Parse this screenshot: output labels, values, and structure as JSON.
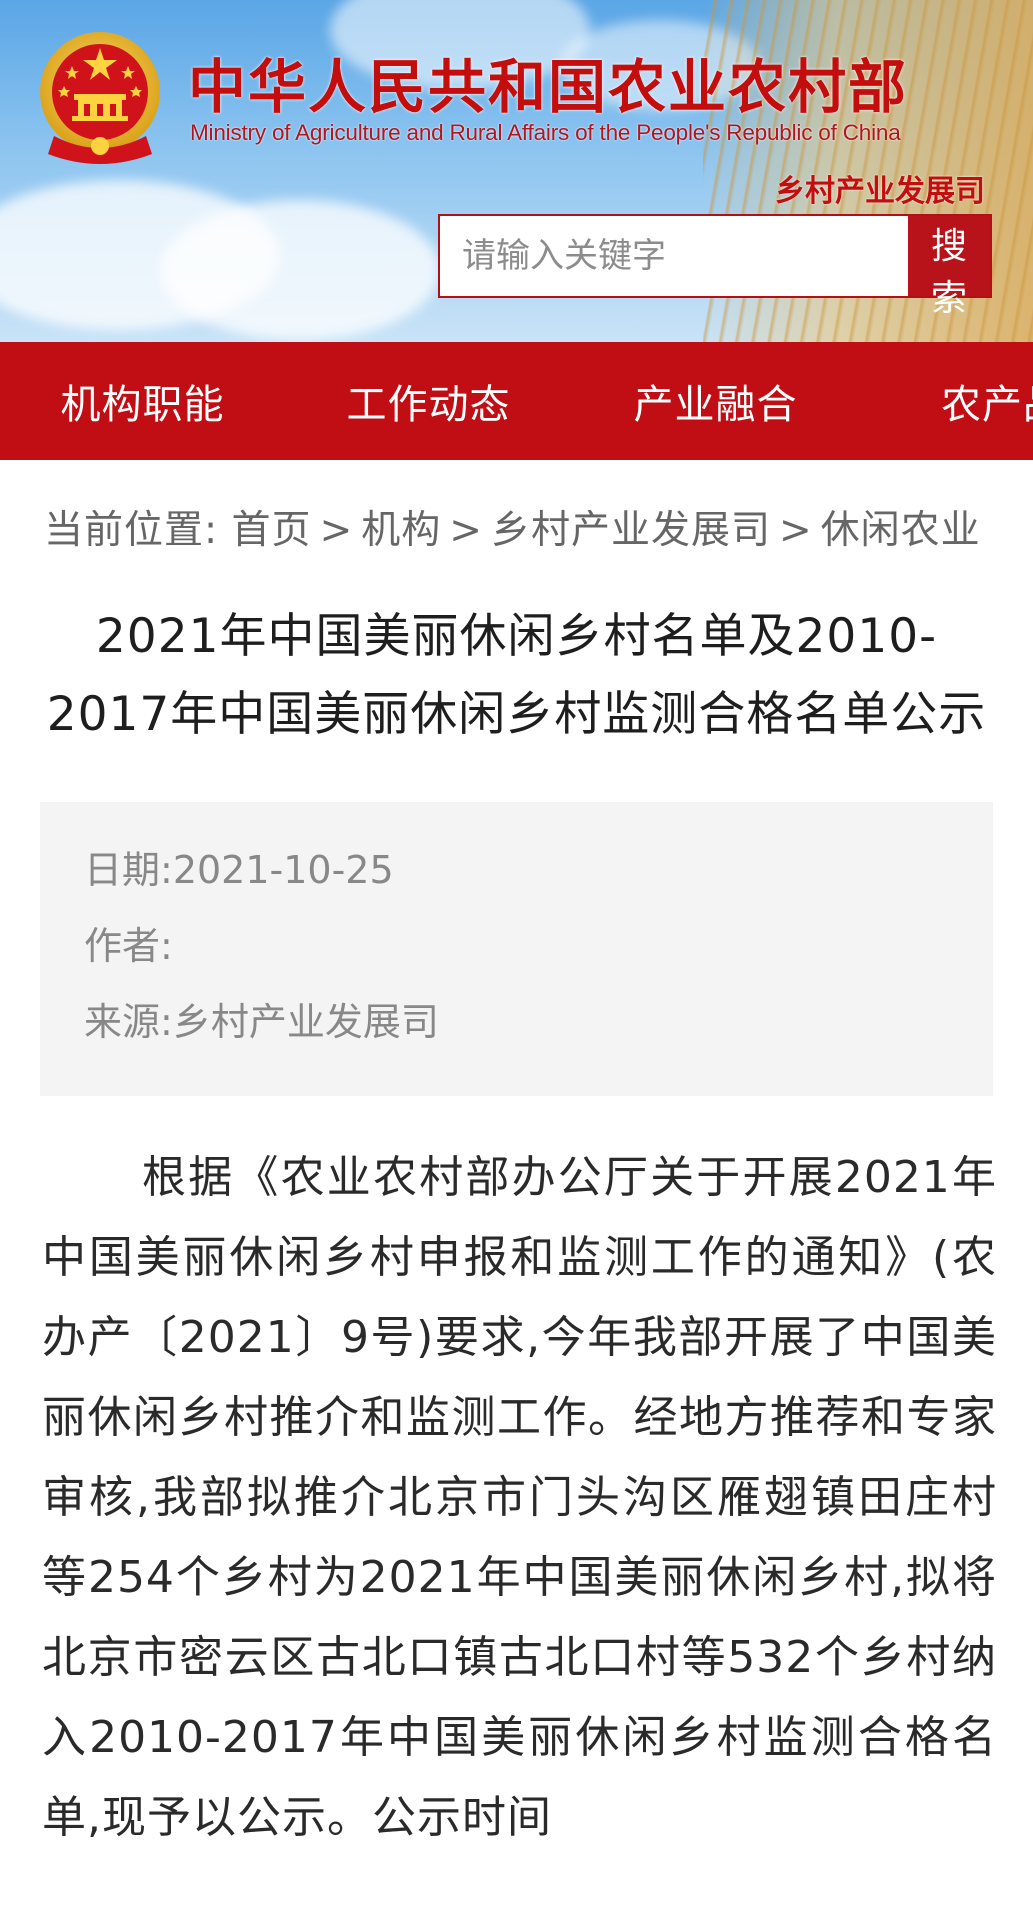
{
  "header": {
    "title_cn": "中华人民共和国农业农村部",
    "title_en": "Ministry of Agriculture and Rural Affairs of the People's Republic of China",
    "department": "乡村产业发展司",
    "emblem_icon": "national-emblem-icon",
    "search": {
      "placeholder": "请输入关键字",
      "button_label": "搜索"
    },
    "colors": {
      "brand_red": "#c10d14",
      "sky_blue": "#8ec5f0",
      "wheat": "#deaf5f"
    }
  },
  "nav": {
    "items": [
      {
        "label": "机构职能"
      },
      {
        "label": "工作动态"
      },
      {
        "label": "产业融合"
      },
      {
        "label": "农产品"
      }
    ]
  },
  "breadcrumb": {
    "prefix": "当前位置:",
    "items": [
      "首页",
      "机构",
      "乡村产业发展司",
      "休闲农业"
    ],
    "separator": ">"
  },
  "article": {
    "title": "2021年中国美丽休闲乡村名单及2010-2017年中国美丽休闲乡村监测合格名单公示",
    "meta": {
      "date_label": "日期:",
      "date_value": "2021-10-25",
      "author_label": "作者:",
      "author_value": "",
      "source_label": "来源:",
      "source_value": "乡村产业发展司"
    },
    "body": "根据《农业农村部办公厅关于开展2021年中国美丽休闲乡村申报和监测工作的通知》(农办产〔2021〕9号)要求,今年我部开展了中国美丽休闲乡村推介和监测工作。经地方推荐和专家审核,我部拟推介北京市门头沟区雁翅镇田庄村等254个乡村为2021年中国美丽休闲乡村,拟将北京市密云区古北口镇古北口村等532个乡村纳入2010-2017年中国美丽休闲乡村监测合格名单,现予以公示。公示时间"
  }
}
